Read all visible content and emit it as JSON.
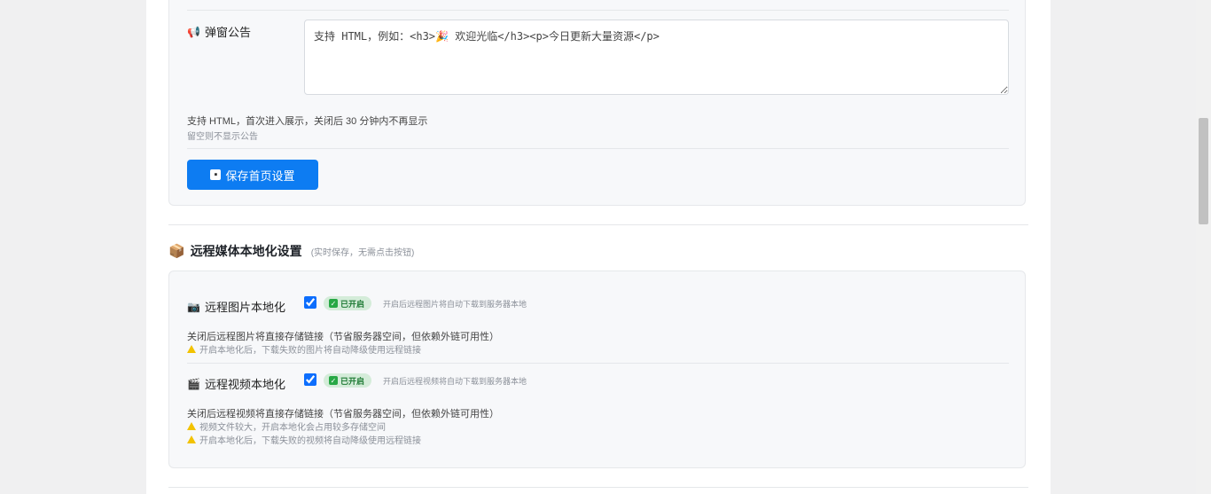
{
  "popup": {
    "label": "弹窗公告",
    "icon": "megaphone-icon",
    "placeholder": "支持 HTML，例如：<h3>🎉 欢迎光临</h3><p>今日更新大量资源</p>",
    "help": "支持 HTML，首次进入展示，关闭后 30 分钟内不再显示",
    "sub": "留空则不显示公告"
  },
  "save_button": {
    "label": "保存首页设置",
    "icon": "floppy-disk-icon"
  },
  "media_section": {
    "title": "远程媒体本地化设置",
    "note": "(实时保存，无需点击按钮)",
    "icon": "package-icon"
  },
  "image_local": {
    "label": "远程图片本地化",
    "icon": "camera-icon",
    "checked": true,
    "badge": "已开启",
    "hint": "开启后远程图片将自动下载到服务器本地",
    "help": "关闭后远程图片将直接存储链接（节省服务器空间，但依赖外链可用性）",
    "warnings": [
      "开启本地化后，下载失败的图片将自动降级使用远程链接"
    ]
  },
  "video_local": {
    "label": "远程视频本地化",
    "icon": "clapperboard-icon",
    "checked": true,
    "badge": "已开启",
    "hint": "开启后远程视频将自动下载到服务器本地",
    "help": "关闭后远程视频将直接存储链接（节省服务器空间，但依赖外链可用性）",
    "warnings": [
      "视频文件较大，开启本地化会占用较多存储空间",
      "开启本地化后，下载失败的视频将自动降级使用远程链接"
    ]
  },
  "colors": {
    "primary": "#0d7cf2",
    "badge_bg": "#d4ecd9",
    "badge_text": "#1e7a34",
    "warning": "#f2c200"
  }
}
